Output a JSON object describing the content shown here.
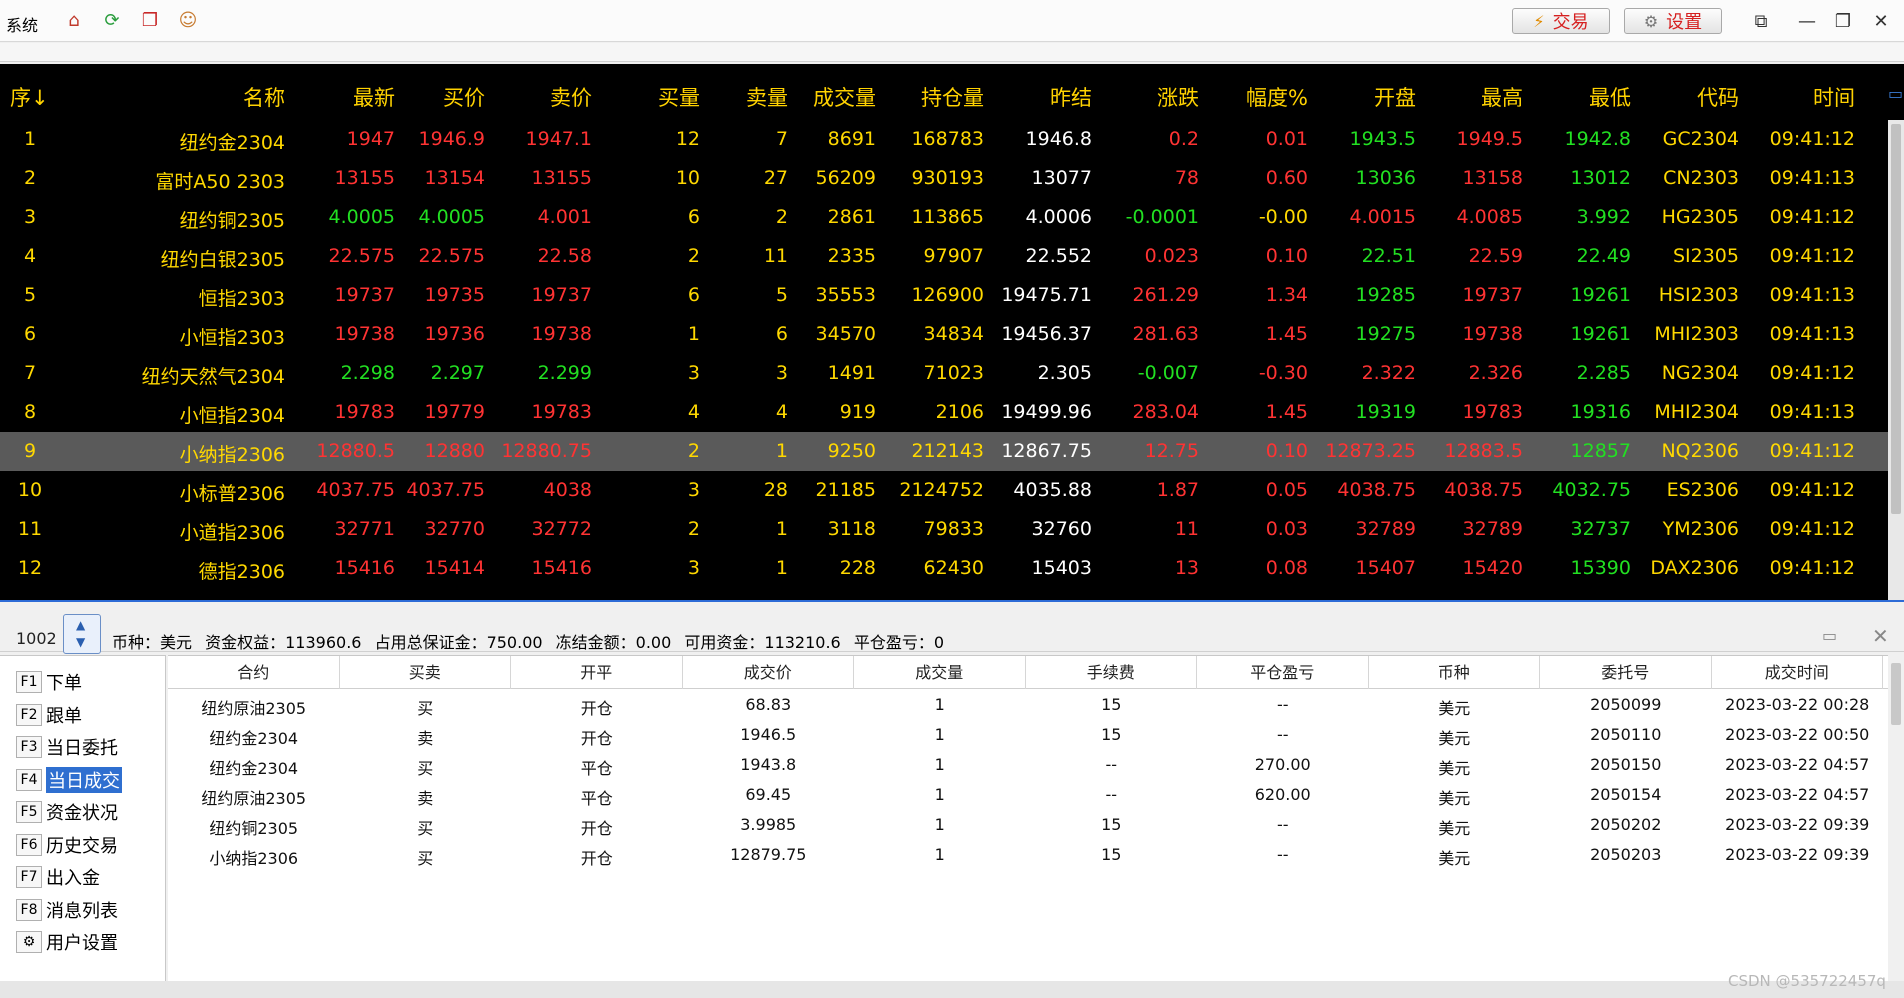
{
  "topbar": {
    "menu_label": "系统",
    "icons": [
      "home-icon",
      "refresh-icon",
      "windows-icon",
      "user-icon"
    ],
    "trade_button": "交易",
    "settings_button": "设置"
  },
  "colors": {
    "accent": "#2f6fd0",
    "up": "#ff3333",
    "down": "#22e022",
    "label": "#ffd800",
    "selected_row": "#5a5a5a"
  },
  "quote": {
    "headers": [
      "序↓",
      "名称",
      "最新",
      "买价",
      "卖价",
      "买量",
      "卖量",
      "成交量",
      "持仓量",
      "昨结",
      "涨跌",
      "幅度%",
      "开盘",
      "最高",
      "最低",
      "代码",
      "时间"
    ],
    "selected_index": 8,
    "rows": [
      [
        "1",
        "纽约金2304",
        "1947",
        "1946.9",
        "1947.1",
        "12",
        "7",
        "8691",
        "168783",
        "1946.8",
        "0.2",
        "0.01",
        "1943.5",
        "1949.5",
        "1942.8",
        "GC2304",
        "09:41:12"
      ],
      [
        "2",
        "富时A50 2303",
        "13155",
        "13154",
        "13155",
        "10",
        "27",
        "56209",
        "930193",
        "13077",
        "78",
        "0.60",
        "13036",
        "13158",
        "13012",
        "CN2303",
        "09:41:13"
      ],
      [
        "3",
        "纽约铜2305",
        "4.0005",
        "4.0005",
        "4.001",
        "6",
        "2",
        "2861",
        "113865",
        "4.0006",
        "-0.0001",
        "-0.00",
        "4.0015",
        "4.0085",
        "3.992",
        "HG2305",
        "09:41:12"
      ],
      [
        "4",
        "纽约白银2305",
        "22.575",
        "22.575",
        "22.58",
        "2",
        "11",
        "2335",
        "97907",
        "22.552",
        "0.023",
        "0.10",
        "22.51",
        "22.59",
        "22.49",
        "SI2305",
        "09:41:12"
      ],
      [
        "5",
        "恒指2303",
        "19737",
        "19735",
        "19737",
        "6",
        "5",
        "35553",
        "126900",
        "19475.71",
        "261.29",
        "1.34",
        "19285",
        "19737",
        "19261",
        "HSI2303",
        "09:41:13"
      ],
      [
        "6",
        "小恒指2303",
        "19738",
        "19736",
        "19738",
        "1",
        "6",
        "34570",
        "34834",
        "19456.37",
        "281.63",
        "1.45",
        "19275",
        "19738",
        "19261",
        "MHI2303",
        "09:41:13"
      ],
      [
        "7",
        "纽约天然气2304",
        "2.298",
        "2.297",
        "2.299",
        "3",
        "3",
        "1491",
        "71023",
        "2.305",
        "-0.007",
        "-0.30",
        "2.322",
        "2.326",
        "2.285",
        "NG2304",
        "09:41:12"
      ],
      [
        "8",
        "小恒指2304",
        "19783",
        "19779",
        "19783",
        "4",
        "4",
        "919",
        "2106",
        "19499.96",
        "283.04",
        "1.45",
        "19319",
        "19783",
        "19316",
        "MHI2304",
        "09:41:13"
      ],
      [
        "9",
        "小纳指2306",
        "12880.5",
        "12880",
        "12880.75",
        "2",
        "1",
        "9250",
        "212143",
        "12867.75",
        "12.75",
        "0.10",
        "12873.25",
        "12883.5",
        "12857",
        "NQ2306",
        "09:41:12"
      ],
      [
        "10",
        "小标普2306",
        "4037.75",
        "4037.75",
        "4038",
        "3",
        "28",
        "21185",
        "2124752",
        "4035.88",
        "1.87",
        "0.05",
        "4038.75",
        "4038.75",
        "4032.75",
        "ES2306",
        "09:41:12"
      ],
      [
        "11",
        "小道指2306",
        "32771",
        "32770",
        "32772",
        "2",
        "1",
        "3118",
        "79833",
        "32760",
        "11",
        "0.03",
        "32789",
        "32789",
        "32737",
        "YM2306",
        "09:41:12"
      ],
      [
        "12",
        "德指2306",
        "15416",
        "15414",
        "15416",
        "3",
        "1",
        "228",
        "62430",
        "15403",
        "13",
        "0.08",
        "15407",
        "15420",
        "15390",
        "DAX2306",
        "09:41:12"
      ]
    ],
    "row_colors": [
      [
        "y",
        "y",
        "r",
        "r",
        "r",
        "y",
        "y",
        "y",
        "y",
        "w",
        "r",
        "r",
        "g",
        "r",
        "g",
        "y",
        "y"
      ],
      [
        "y",
        "y",
        "r",
        "r",
        "r",
        "y",
        "y",
        "y",
        "y",
        "w",
        "r",
        "r",
        "g",
        "r",
        "g",
        "y",
        "y"
      ],
      [
        "y",
        "y",
        "g",
        "g",
        "r",
        "y",
        "y",
        "y",
        "y",
        "w",
        "g",
        "y",
        "r",
        "r",
        "g",
        "y",
        "y"
      ],
      [
        "y",
        "y",
        "r",
        "r",
        "r",
        "y",
        "y",
        "y",
        "y",
        "w",
        "r",
        "r",
        "g",
        "r",
        "g",
        "y",
        "y"
      ],
      [
        "y",
        "y",
        "r",
        "r",
        "r",
        "y",
        "y",
        "y",
        "y",
        "w",
        "r",
        "r",
        "g",
        "r",
        "g",
        "y",
        "y"
      ],
      [
        "y",
        "y",
        "r",
        "r",
        "r",
        "y",
        "y",
        "y",
        "y",
        "w",
        "r",
        "r",
        "g",
        "r",
        "g",
        "y",
        "y"
      ],
      [
        "y",
        "y",
        "g",
        "g",
        "g",
        "y",
        "y",
        "y",
        "y",
        "w",
        "g",
        "r",
        "r",
        "r",
        "g",
        "y",
        "y"
      ],
      [
        "y",
        "y",
        "r",
        "r",
        "r",
        "y",
        "y",
        "y",
        "y",
        "w",
        "r",
        "r",
        "g",
        "r",
        "g",
        "y",
        "y"
      ],
      [
        "y",
        "y",
        "r",
        "r",
        "r",
        "y",
        "y",
        "y",
        "y",
        "w",
        "r",
        "r",
        "r",
        "r",
        "g",
        "y",
        "y"
      ],
      [
        "y",
        "y",
        "r",
        "r",
        "r",
        "y",
        "y",
        "y",
        "y",
        "w",
        "r",
        "r",
        "r",
        "r",
        "g",
        "y",
        "y"
      ],
      [
        "y",
        "y",
        "r",
        "r",
        "r",
        "y",
        "y",
        "y",
        "y",
        "w",
        "r",
        "r",
        "r",
        "r",
        "g",
        "y",
        "y"
      ],
      [
        "y",
        "y",
        "r",
        "r",
        "r",
        "y",
        "y",
        "y",
        "y",
        "w",
        "r",
        "r",
        "r",
        "r",
        "g",
        "y",
        "y"
      ]
    ]
  },
  "account": {
    "id": "1002",
    "currency": "币种：美元",
    "equity": "资金权益：113960.6",
    "margin": "占用总保证金：750.00",
    "frozen": "冻结金额：0.00",
    "available": "可用资金：113210.6",
    "close_pnl": "平仓盈亏：0"
  },
  "nav": {
    "items": [
      {
        "key": "F1",
        "label": "下单"
      },
      {
        "key": "F2",
        "label": "跟单"
      },
      {
        "key": "F3",
        "label": "当日委托"
      },
      {
        "key": "F4",
        "label": "当日成交"
      },
      {
        "key": "F5",
        "label": "资金状况"
      },
      {
        "key": "F6",
        "label": "历史交易"
      },
      {
        "key": "F7",
        "label": "出入金"
      },
      {
        "key": "F8",
        "label": "消息列表"
      },
      {
        "key": "⚙",
        "label": "用户设置"
      }
    ],
    "active_index": 3
  },
  "trades": {
    "headers": [
      "合约",
      "买卖",
      "开平",
      "成交价",
      "成交量",
      "手续费",
      "平仓盈亏",
      "币种",
      "委托号",
      "成交时间"
    ],
    "rows": [
      [
        "纽约原油2305",
        "买",
        "开仓",
        "68.83",
        "1",
        "15",
        "--",
        "美元",
        "2050099",
        "2023-03-22 00:28"
      ],
      [
        "纽约金2304",
        "卖",
        "开仓",
        "1946.5",
        "1",
        "15",
        "--",
        "美元",
        "2050110",
        "2023-03-22 00:50"
      ],
      [
        "纽约金2304",
        "买",
        "平仓",
        "1943.8",
        "1",
        "--",
        "270.00",
        "美元",
        "2050150",
        "2023-03-22 04:57"
      ],
      [
        "纽约原油2305",
        "卖",
        "平仓",
        "69.45",
        "1",
        "--",
        "620.00",
        "美元",
        "2050154",
        "2023-03-22 04:57"
      ],
      [
        "纽约铜2305",
        "买",
        "开仓",
        "3.9985",
        "1",
        "15",
        "--",
        "美元",
        "2050202",
        "2023-03-22 09:39"
      ],
      [
        "小纳指2306",
        "买",
        "开仓",
        "12879.75",
        "1",
        "15",
        "--",
        "美元",
        "2050203",
        "2023-03-22 09:39"
      ]
    ]
  },
  "watermark": "CSDN @535722457q"
}
